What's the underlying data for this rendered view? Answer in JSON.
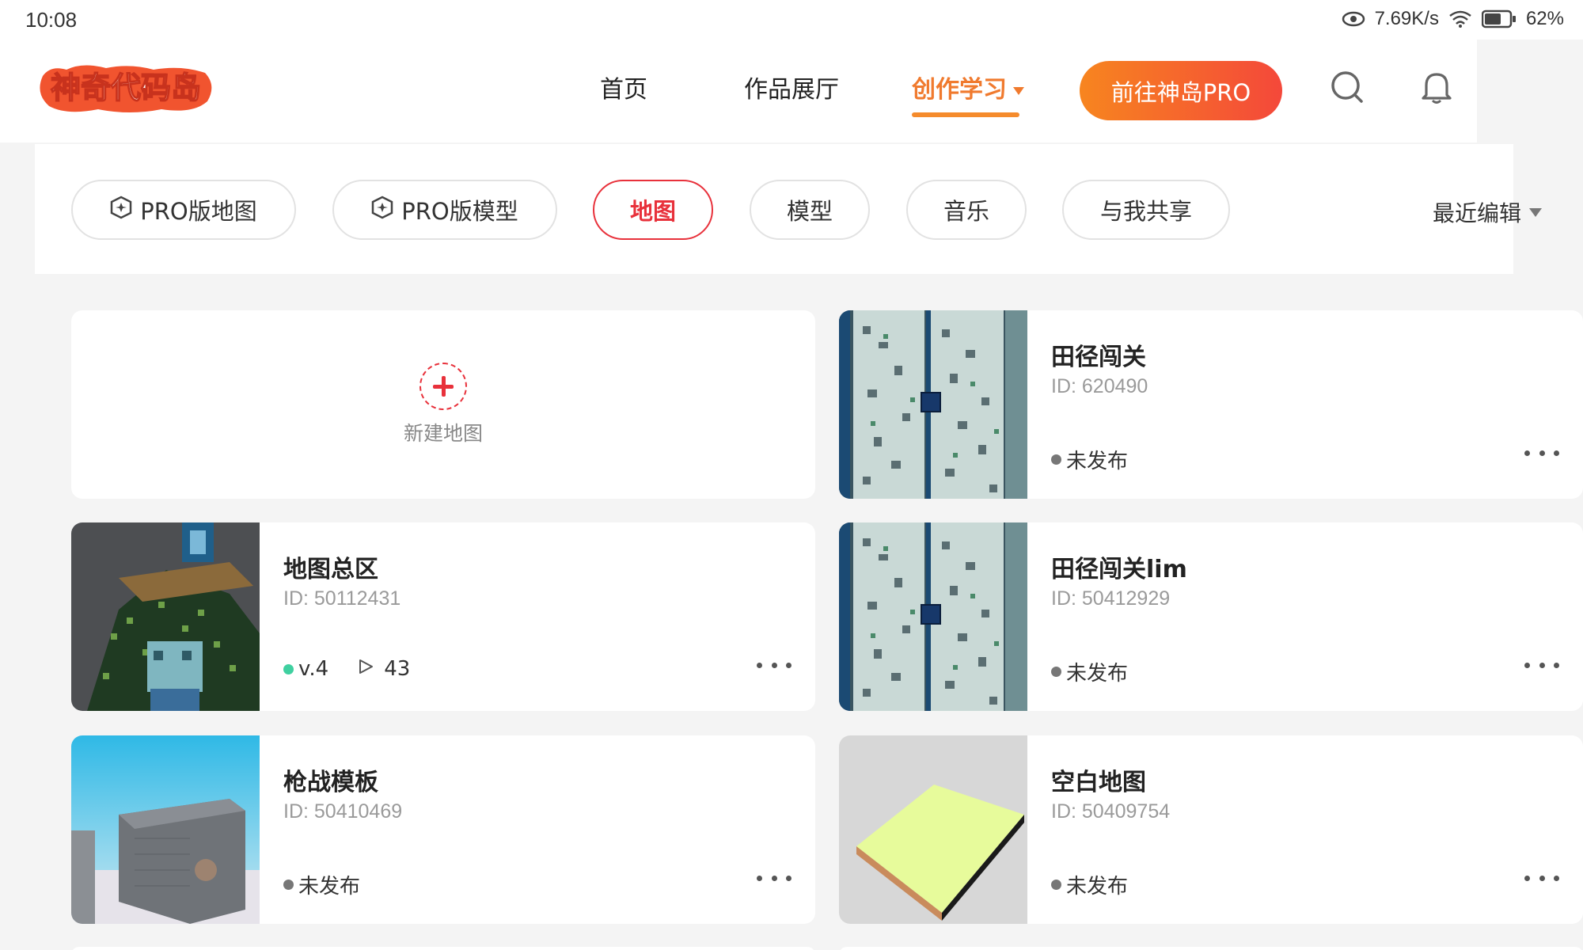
{
  "status_bar": {
    "time": "10:08",
    "net_speed": "7.69K/s",
    "battery": "62%"
  },
  "header": {
    "logo_text": "神奇代码岛",
    "nav": [
      {
        "label": "首页"
      },
      {
        "label": "作品展厅"
      },
      {
        "label": "创作学习"
      }
    ],
    "pro_button": "前往神岛PRO"
  },
  "filters": {
    "chips": [
      {
        "label": "PRO版地图"
      },
      {
        "label": "PRO版模型"
      },
      {
        "label": "地图"
      },
      {
        "label": "模型"
      },
      {
        "label": "音乐"
      },
      {
        "label": "与我共享"
      }
    ],
    "sort_label": "最近编辑"
  },
  "new_map": {
    "label": "新建地图"
  },
  "cards": [
    {
      "title": "田径闯关",
      "id_text": "ID: 620490",
      "status": "未发布"
    },
    {
      "title": "地图总区",
      "id_text": "ID: 50112431",
      "version": "v.4",
      "plays": "43"
    },
    {
      "title": "田径闯关lim",
      "id_text": "ID: 50412929",
      "status": "未发布"
    },
    {
      "title": "枪战模板",
      "id_text": "ID: 50410469",
      "status": "未发布"
    },
    {
      "title": "空白地图",
      "id_text": "ID: 50409754",
      "status": "未发布"
    }
  ],
  "colors": {
    "accent_orange": "#f07a2e",
    "accent_red": "#e8313b",
    "published_green": "#3fd0a0"
  }
}
